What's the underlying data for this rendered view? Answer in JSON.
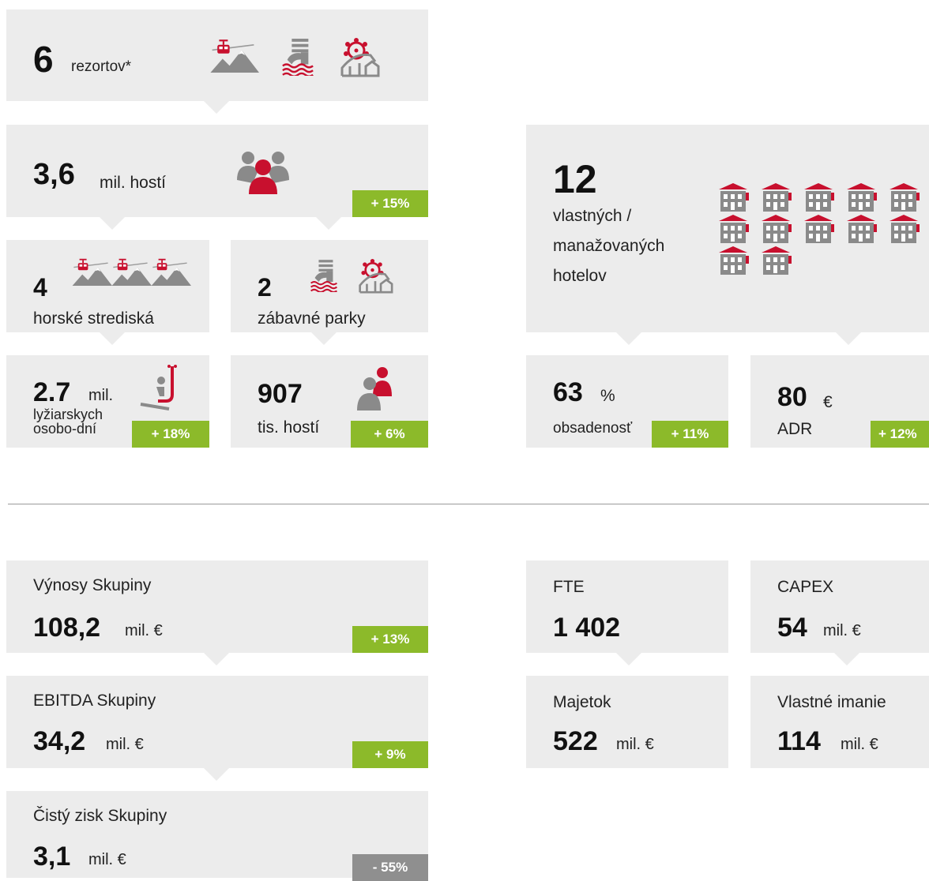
{
  "colors": {
    "panel": "#ececec",
    "accent_red": "#c8102e",
    "icon_gray": "#8a8a8a",
    "positive_badge": "#8cba2a",
    "negative_badge": "#8f8f8f"
  },
  "resorts": {
    "value": "6",
    "label": "rezortov*",
    "icons": [
      "cable-car-mountain-icon",
      "waterpark-slide-icon",
      "ferris-wheel-coaster-icon"
    ]
  },
  "guests": {
    "value": "3,6",
    "label": "mil. hostí",
    "change": "+ 15%",
    "icon": "people-group-icon"
  },
  "mountain": {
    "value": "4",
    "label": "horské strediská",
    "icons": [
      "cable-car-mountain-icon",
      "cable-car-mountain-icon",
      "cable-car-mountain-icon"
    ]
  },
  "parks": {
    "value": "2",
    "label": "zábavné parky",
    "icons": [
      "waterpark-slide-icon",
      "ferris-wheel-coaster-icon"
    ]
  },
  "skier_days": {
    "value": "2.7",
    "unit": "mil.",
    "line1": "lyžiarskych",
    "line2": "osobo-dní",
    "change": "+ 18%",
    "icon": "chairlift-skier-icon"
  },
  "park_guests": {
    "value": "907",
    "label": "tis. hostí",
    "change": "+ 6%",
    "icon": "guests-pair-icon"
  },
  "hotels": {
    "value": "12",
    "line1": "vlastných /",
    "line2": "manažovaných",
    "line3": "hotelov",
    "hotel_icon_count": 12
  },
  "occupancy": {
    "value": "63",
    "unit": "%",
    "label": "obsadenosť",
    "change": "+ 11%"
  },
  "adr": {
    "value": "80",
    "unit": "€",
    "label": "ADR",
    "change": "+ 12%"
  },
  "revenue": {
    "label": "Výnosy Skupiny",
    "value": "108,2",
    "unit": "mil. €",
    "change": "+ 13%"
  },
  "ebitda": {
    "label": "EBITDA Skupiny",
    "value": "34,2",
    "unit": "mil. €",
    "change": "+ 9%"
  },
  "net_profit": {
    "label": "Čistý zisk Skupiny",
    "value": "3,1",
    "unit": "mil. €",
    "change": "- 55%"
  },
  "fte": {
    "label": "FTE",
    "value": "1 402"
  },
  "capex": {
    "label": "CAPEX",
    "value": "54",
    "unit": "mil. €"
  },
  "assets": {
    "label": "Majetok",
    "value": "522",
    "unit": "mil. €"
  },
  "equity": {
    "label": "Vlastné imanie",
    "value": "114",
    "unit": "mil. €"
  }
}
